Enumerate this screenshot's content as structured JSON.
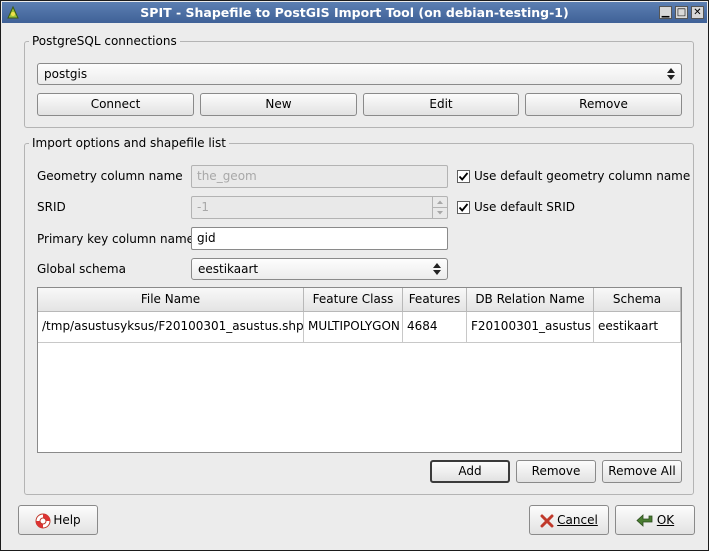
{
  "window": {
    "title": "SPIT - Shapefile to PostGIS Import Tool (on debian-testing-1)",
    "minimize": "▁",
    "maximize": "□",
    "close": "✕"
  },
  "connections": {
    "group_title": "PostgreSQL connections",
    "selected": "postgis",
    "connect_label": "Connect",
    "new_label": "New",
    "edit_label": "Edit",
    "remove_label": "Remove"
  },
  "import": {
    "group_title": "Import options and shapefile list",
    "geom_label": "Geometry column name",
    "geom_value": "the_geom",
    "use_default_geom_label": "Use default geometry column name",
    "use_default_geom_checked": true,
    "srid_label": "SRID",
    "srid_value": "-1",
    "use_default_srid_label": "Use default SRID",
    "use_default_srid_checked": true,
    "pk_label": "Primary key column name",
    "pk_value": "gid",
    "schema_label": "Global schema",
    "schema_value": "eestikaart"
  },
  "table": {
    "columns": [
      "File Name",
      "Feature Class",
      "Features",
      "DB Relation Name",
      "Schema"
    ],
    "rows": [
      [
        "/tmp/asustusyksus/F20100301_asustus.shp",
        "MULTIPOLYGON",
        "4684",
        "F20100301_asustus",
        "eestikaart"
      ]
    ]
  },
  "list_buttons": {
    "add_label": "Add",
    "remove_label": "Remove",
    "remove_all_label": "Remove All"
  },
  "footer": {
    "help_label": "Help",
    "cancel_label": "Cancel",
    "ok_label": "OK"
  }
}
